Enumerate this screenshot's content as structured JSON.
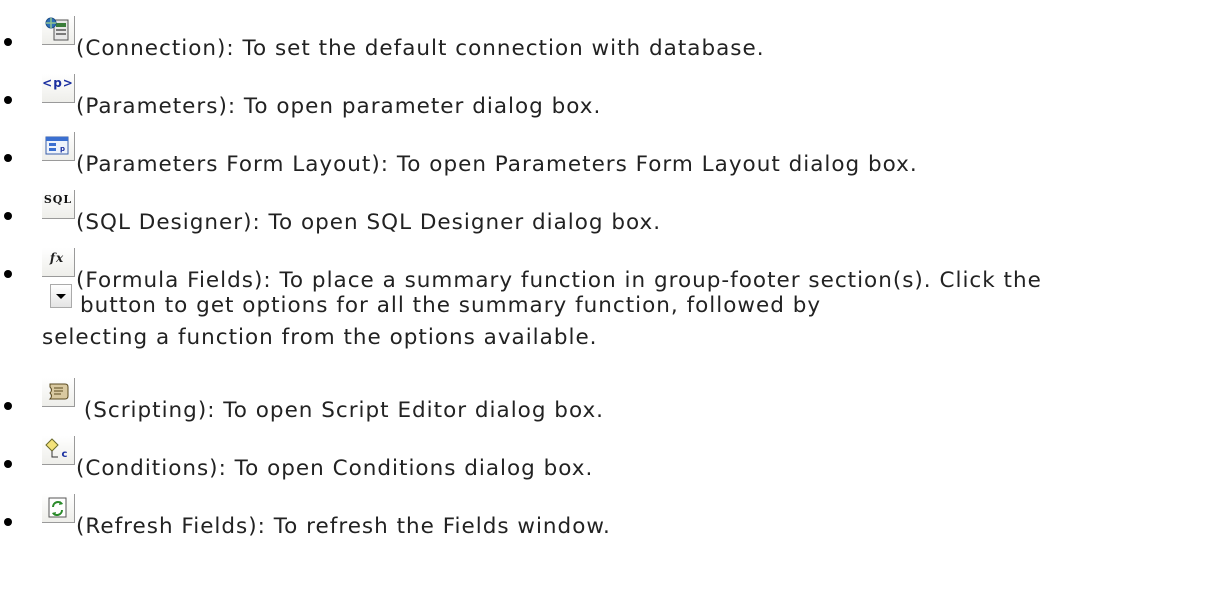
{
  "items": [
    {
      "icon": "connection-icon",
      "text": "(Connection): To set the default connection with database."
    },
    {
      "icon": "parameters-icon",
      "icon_glyph": "<p>",
      "text": "(Parameters): To open parameter dialog box."
    },
    {
      "icon": "parameters-form-layout-icon",
      "text": "(Parameters Form Layout): To open Parameters Form Layout dialog box."
    },
    {
      "icon": "sql-designer-icon",
      "icon_glyph": "SQL",
      "text": "(SQL Designer): To open SQL Designer dialog box."
    },
    {
      "icon": "formula-fields-icon",
      "icon_glyph": "fx",
      "text": "(Formula Fields): To place a summary function in group-footer section(s). Click the",
      "inline_icon": "dropdown-arrow-icon",
      "text_after_line1": "button to get options for all the summary function, followed by",
      "text_line3": "selecting a function from the options available."
    },
    {
      "icon": "scripting-icon",
      "text": " (Scripting): To open Script Editor dialog box."
    },
    {
      "icon": "conditions-icon",
      "icon_glyph": "c",
      "text": "(Conditions): To open Conditions dialog box."
    },
    {
      "icon": "refresh-fields-icon",
      "text": "(Refresh Fields): To refresh the Fields window."
    }
  ]
}
